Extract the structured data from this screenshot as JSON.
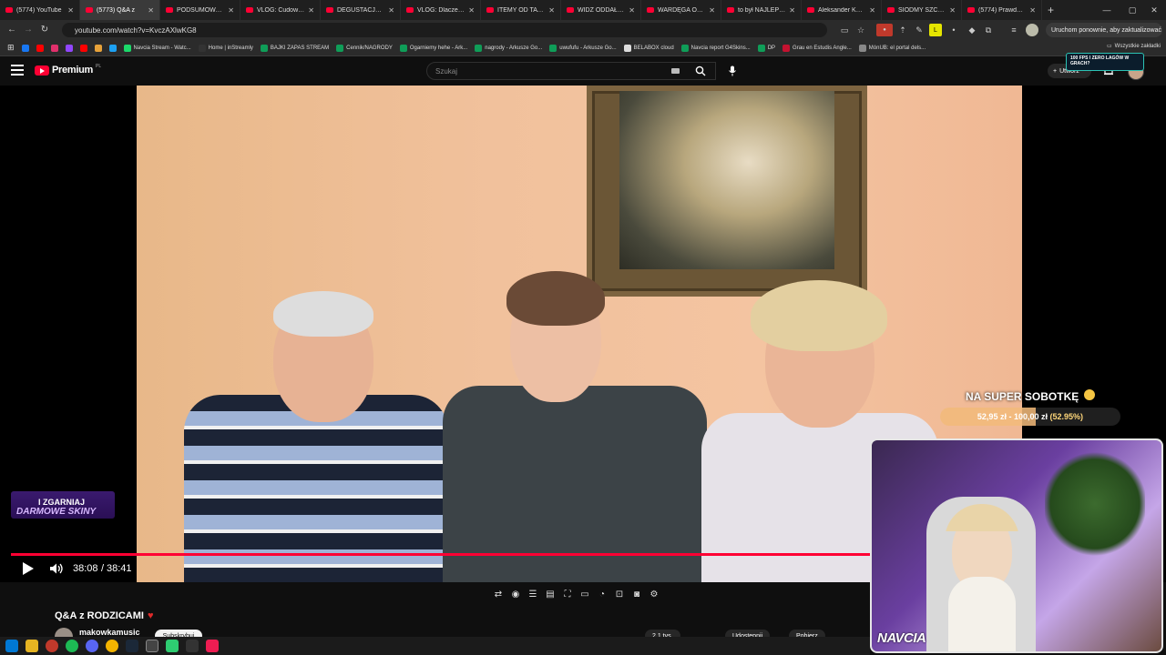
{
  "browser": {
    "tabs": [
      {
        "label": "(5774) YouTube",
        "active": false
      },
      {
        "label": "(5773) Q&A z",
        "active": true
      },
      {
        "label": "PODSUMOWANIE",
        "active": false
      },
      {
        "label": "VLOG: Cudowny za",
        "active": false
      },
      {
        "label": "DEGUSTACJA | JU",
        "active": false
      },
      {
        "label": "VLOG: Dlaczego to",
        "active": false
      },
      {
        "label": "ITEMY OD TATY | K",
        "active": false
      },
      {
        "label": "WIDZ ODDAŁ STR",
        "active": false
      },
      {
        "label": "WARDĘGA OSKAR",
        "active": false
      },
      {
        "label": "to był NAJLEPSZY",
        "active": false
      },
      {
        "label": "Aleksander Kępka",
        "active": false
      },
      {
        "label": "SIÓDMY SZCZYT K",
        "active": false
      },
      {
        "label": "(5774) Prawdziwy",
        "active": false
      }
    ],
    "new_tab": "+",
    "url": "youtube.com/watch?v=KvczAXlwKG8",
    "update_button": "Uruchom ponownie, aby zaktualizować",
    "bookmarks": [
      {
        "label": "",
        "color": "#1877f2"
      },
      {
        "label": "",
        "color": "#ff0000"
      },
      {
        "label": "",
        "color": "#e1306c"
      },
      {
        "label": "",
        "color": "#9146ff"
      },
      {
        "label": "",
        "color": "#ff0000"
      },
      {
        "label": "",
        "color": "#e7a23a"
      },
      {
        "label": "",
        "color": "#1da1f2"
      },
      {
        "label": "Navcia Stream - Watc...",
        "color": "#1bd96a"
      },
      {
        "label": "Home | inStreamly",
        "color": "#333333"
      },
      {
        "label": "BAJKI ZAPAS STREAM",
        "color": "#0f9d58"
      },
      {
        "label": "Cennik/NAGRODY",
        "color": "#0f9d58"
      },
      {
        "label": "Ogarniemy hehe - Ark...",
        "color": "#0f9d58"
      },
      {
        "label": "nagrody - Arkusze Go...",
        "color": "#0f9d58"
      },
      {
        "label": "uwufufu - Arkusze Go...",
        "color": "#0f9d58"
      },
      {
        "label": "BELABOX cloud",
        "color": "#dddddd"
      },
      {
        "label": "Navcia report G4Skins...",
        "color": "#0f9d58"
      },
      {
        "label": "DP",
        "color": "#0f9d58"
      },
      {
        "label": "Grau en Estudis Angle...",
        "color": "#c41230"
      },
      {
        "label": "MónUB: el portal dels...",
        "color": "#888888"
      }
    ],
    "all_bookmarks": "Wszystkie zakładki"
  },
  "youtube": {
    "logo_text": "Premium",
    "logo_region": "PL",
    "search_placeholder": "Szukaj",
    "create_label": "Utwórz",
    "overlay_ad": "100 FPS I ZERO LAGÓW W GRACH?"
  },
  "player": {
    "time_current": "38:08",
    "time_separator": "/",
    "time_total": "38:41",
    "progress": 0.9858,
    "promo_line1": "I ZGARNIAJ",
    "promo_line2": "DARMOWE SKINY",
    "goal_title": "NA SUPER SOBOTKĘ",
    "goal_current": "52,95 zł",
    "goal_separator": "-",
    "goal_target": "100,00 zł",
    "goal_percent": "(52.95%)",
    "goal_fraction": 0.5295,
    "webcam_logo": "NAVCIA"
  },
  "video": {
    "title": "Q&A z RODZICAMI",
    "channel": "makowkamusic",
    "subscribe": "Subskrybuj",
    "views": "2,1 tys.",
    "share": "Udostępnij",
    "save": "Pobierz"
  }
}
